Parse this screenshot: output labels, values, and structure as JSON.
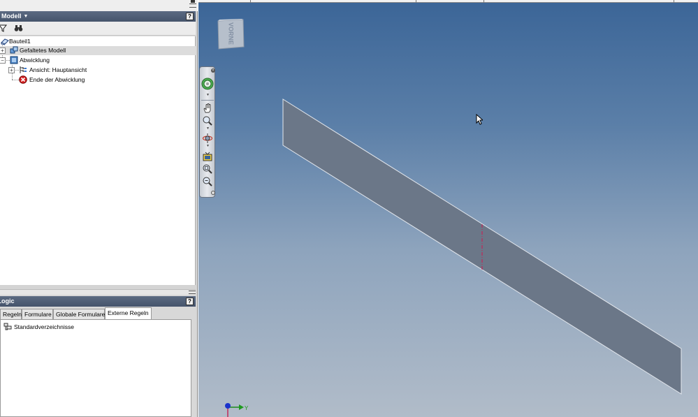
{
  "model_panel": {
    "title": "Modell",
    "help_label": "?",
    "tree": [
      {
        "label": "Bauteil1"
      },
      {
        "label": "Gefaltetes Modell"
      },
      {
        "label": "Abwicklung"
      },
      {
        "label": "Ansicht: Hauptansicht"
      },
      {
        "label": "Ende der Abwicklung"
      }
    ]
  },
  "ilogic_panel": {
    "title": "iLogic",
    "help_label": "?",
    "tabs": [
      {
        "label": "Regeln"
      },
      {
        "label": "Formulare"
      },
      {
        "label": "Globale Formulare"
      },
      {
        "label": "Externe Regeln"
      }
    ],
    "active_tab": "Externe Regeln",
    "items": [
      {
        "label": "Standardverzeichnisse"
      }
    ]
  },
  "viewport": {
    "viewcube_face": "VORNE",
    "triad_label": "Y",
    "icons": [
      "filter-icon",
      "find-icon",
      "steering-wheel-icon",
      "pan-icon",
      "zoom-icon",
      "orbit-icon",
      "view-face-icon",
      "zoom-window-icon",
      "zoom-all-icon"
    ],
    "colors": {
      "background_top": "#3b6597",
      "background_bottom": "#b1bcc9",
      "sheet": "#6b7788",
      "bend_line": "#c0285a"
    }
  }
}
